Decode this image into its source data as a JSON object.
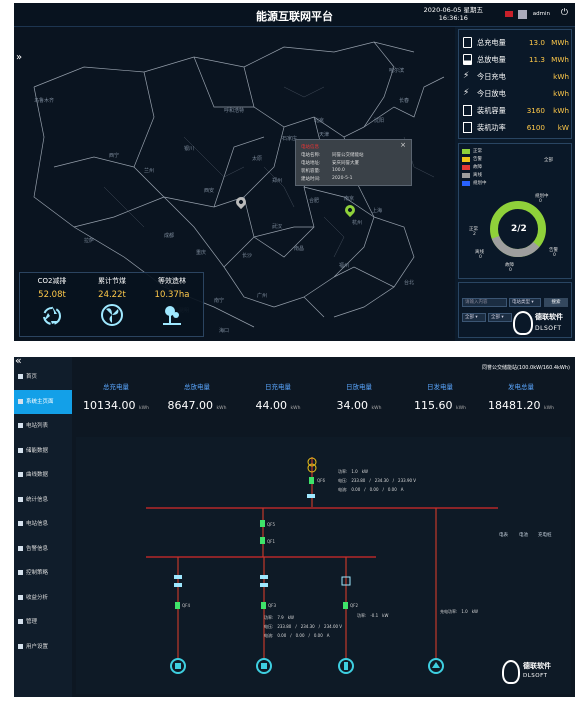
{
  "screen1": {
    "title": "能源互联网平台",
    "date": "2020-06-05 星期五",
    "time": "16:36:16",
    "user": "admin",
    "expand_icon": "double-chevron-right",
    "cities": [
      "乌鲁木齐",
      "呼和浩特",
      "北京",
      "天津",
      "石家庄",
      "太原",
      "银川",
      "兰州",
      "西宁",
      "济南",
      "郑州",
      "西安",
      "南京",
      "合肥",
      "上海",
      "杭州",
      "武汉",
      "成都",
      "重庆",
      "长沙",
      "南昌",
      "福州",
      "贵阳",
      "昆明",
      "南宁",
      "广州",
      "台北",
      "海口",
      "拉萨",
      "哈尔滨",
      "长春",
      "沈阳"
    ],
    "popup": {
      "title": "电站信息",
      "close": "×",
      "rows": [
        {
          "label": "电站名称:",
          "value": "同誉公交储能站"
        },
        {
          "label": "电站地址:",
          "value": "安庆同誉大厦"
        },
        {
          "label": "装机容量:",
          "value": "100.0"
        },
        {
          "label": "建站时间:",
          "value": "2020-5-1"
        }
      ]
    },
    "eco": [
      {
        "label": "CO2减排",
        "value": "52.08t",
        "icon": "recycle-icon"
      },
      {
        "label": "累计节煤",
        "value": "24.22t",
        "icon": "fan-icon"
      },
      {
        "label": "等效造林",
        "value": "10.37ha",
        "icon": "tree-icon"
      }
    ],
    "kpis": [
      {
        "label": "总充电量",
        "value": "13.0",
        "unit": "MWh",
        "icon": "battery-icon"
      },
      {
        "label": "总放电量",
        "value": "11.3",
        "unit": "MWh",
        "icon": "battery-low-icon"
      },
      {
        "label": "今日充电",
        "value": "",
        "unit": "kWh",
        "icon": "bolt-icon"
      },
      {
        "label": "今日放电",
        "value": "",
        "unit": "kWh",
        "icon": "bolt-icon"
      },
      {
        "label": "装机容量",
        "value": "3160",
        "unit": "kWh",
        "icon": "capacity-icon"
      },
      {
        "label": "装机功率",
        "value": "6100",
        "unit": "kW",
        "icon": "power-icon"
      }
    ],
    "legend": [
      {
        "label": "正常",
        "color": "#8fd13a"
      },
      {
        "label": "告警",
        "color": "#f0c419"
      },
      {
        "label": "故障",
        "color": "#e53935"
      },
      {
        "label": "离线",
        "color": "#9e9e9e"
      },
      {
        "label": "规划中",
        "color": "#2962ff"
      }
    ],
    "donut": {
      "center": "2/2",
      "all_label": "全部",
      "segments": [
        {
          "value": 2,
          "color": "#8fd13a"
        },
        {
          "value": 0,
          "color": "#9e9e9e"
        }
      ],
      "labels": [
        {
          "text": "规划中",
          "sub": "0"
        },
        {
          "text": "正常",
          "sub": "2"
        },
        {
          "text": "离线",
          "sub": "0"
        },
        {
          "text": "告警",
          "sub": "0"
        },
        {
          "text": "故障",
          "sub": "0"
        }
      ]
    },
    "filter": {
      "input_placeholder": "请输入内容",
      "select1": "电站类型",
      "search": "搜索",
      "select2": "全部",
      "select3": "全部"
    },
    "logo": {
      "text": "德联软件",
      "sub": "DLSOFT"
    }
  },
  "screen2": {
    "expand_icon": "double-chevron-left",
    "menu": [
      {
        "label": "首页",
        "icon": "home-icon"
      },
      {
        "label": "系统主页面",
        "icon": "server-icon",
        "active": true
      },
      {
        "label": "电站列表",
        "icon": "plug-icon"
      },
      {
        "label": "储能数据",
        "icon": "storage-icon"
      },
      {
        "label": "曲线数据",
        "icon": "chart-icon"
      },
      {
        "label": "统计信息",
        "icon": "stats-icon"
      },
      {
        "label": "电站信息",
        "icon": "wrench-icon"
      },
      {
        "label": "告警信息",
        "icon": "alarm-icon"
      },
      {
        "label": "控制策略",
        "icon": "control-icon"
      },
      {
        "label": "收益分析",
        "icon": "revenue-icon"
      },
      {
        "label": "管理",
        "icon": "manage-icon"
      },
      {
        "label": "用户设置",
        "icon": "user-icon"
      }
    ],
    "site_title": "同誉公交储能站(100.0kW/160.4kWh)",
    "stats": [
      {
        "label": "总充电量",
        "value": "10134.00",
        "unit": "kWh"
      },
      {
        "label": "总放电量",
        "value": "8647.00",
        "unit": "kWh"
      },
      {
        "label": "日充电量",
        "value": "44.00",
        "unit": "kWh"
      },
      {
        "label": "日放电量",
        "value": "34.00",
        "unit": "kWh"
      },
      {
        "label": "日发电量",
        "value": "115.60",
        "unit": "kWh"
      },
      {
        "label": "发电总量",
        "value": "18481.20",
        "unit": "kWh"
      }
    ],
    "diagram_legend": [
      "电表",
      "电池",
      "充电桩"
    ],
    "meter_readings": {
      "top": {
        "line1": "功率:　1.0　kW",
        "line2": "电压:　233.80　/　234.30　/　233.90 V",
        "line3": "电流:　0.00　/　0.00　/　0.00　A"
      },
      "mid": {
        "line1": "功率:　7.9　kW",
        "line2": "电压:　233.80　/　234.30　/　234.00 V",
        "line3": "电流:　0.00　/　0.00　/　0.00　A"
      },
      "right1": "功率:　-0.1　kW",
      "right2": "充电功率:　1.0　kW"
    },
    "breakers": [
      "QF6",
      "QF5",
      "QF1",
      "QF4",
      "QF3",
      "QF2"
    ],
    "logo": {
      "text": "德联软件",
      "sub": "DLSOFT"
    }
  }
}
